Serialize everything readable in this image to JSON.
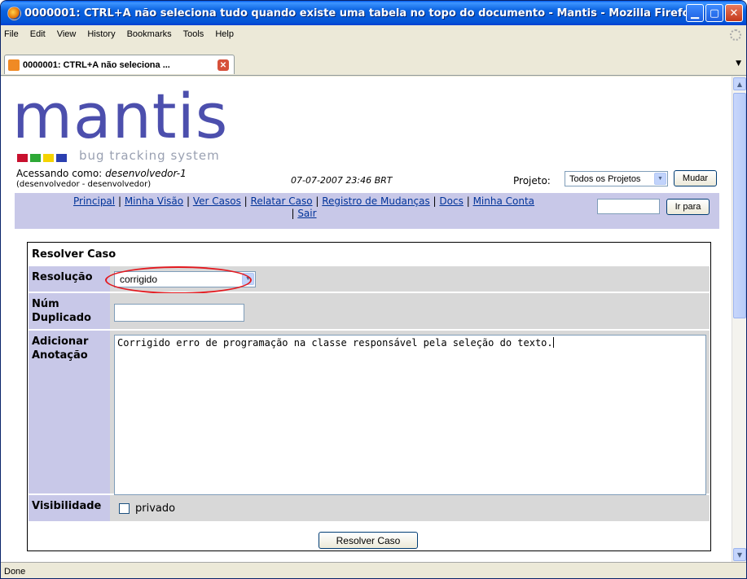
{
  "window": {
    "title": "0000001: CTRL+A não seleciona tudo quando existe uma tabela no topo do documento - Mantis - Mozilla Firefox",
    "minimize": "▁",
    "maximize": "▢",
    "close": "✕"
  },
  "menu": [
    "File",
    "Edit",
    "View",
    "History",
    "Bookmarks",
    "Tools",
    "Help"
  ],
  "tab": {
    "label": "0000001: CTRL+A não seleciona ...",
    "close": "✕",
    "list_arrow": "▼"
  },
  "logo": {
    "word": "mantis",
    "subtitle": "bug tracking system",
    "square_colors": [
      "#c8102e",
      "#2ea836",
      "#f5d300",
      "#2b3fb0"
    ]
  },
  "header": {
    "logged_in_label": "Acessando como:",
    "username": "desenvolvedor-1",
    "user_detail": "(desenvolvedor - desenvolvedor)",
    "datetime": "07-07-2007 23:46 BRT",
    "project_label": "Projeto:",
    "project_value": "Todos os Projetos",
    "switch_button": "Mudar"
  },
  "nav": {
    "links": [
      "Principal",
      "Minha Visão",
      "Ver Casos",
      "Relatar Caso",
      "Registro de Mudanças",
      "Docs",
      "Minha Conta",
      "Sair"
    ],
    "separator": "|",
    "jump_button": "Ir para",
    "jump_value": ""
  },
  "form": {
    "title": "Resolver Caso",
    "resolution_label": "Resolução",
    "resolution_value": "corrigido",
    "duplicate_label": "Núm Duplicado",
    "duplicate_value": "",
    "note_label": "Adicionar Anotação",
    "note_value": "Corrigido erro de programação na classe responsável pela seleção do texto.",
    "visibility_label": "Visibilidade",
    "private_label": "privado",
    "private_checked": false,
    "submit_label": "Resolver Caso"
  },
  "status": "Done",
  "colors": {
    "nav_bg": "#c8c8e8",
    "row_bg": "#d8d8d8",
    "link": "#003399",
    "highlight": "#e3191f"
  }
}
